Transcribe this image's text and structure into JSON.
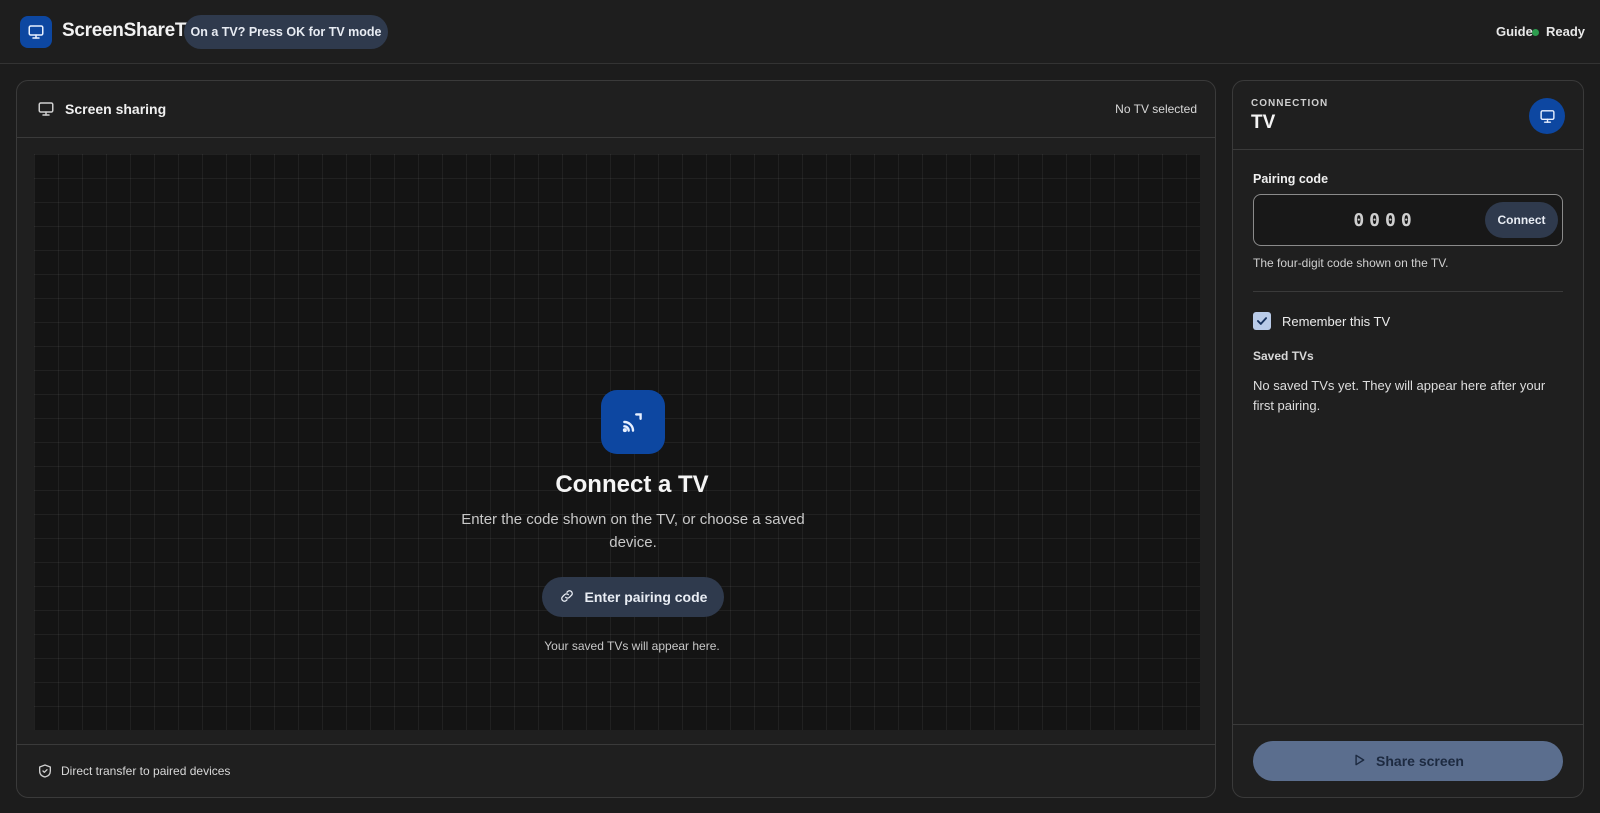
{
  "header": {
    "app_title": "ScreenShareTV",
    "tv_mode_chip": "On a TV? Press OK for TV mode",
    "guide_label": "Guide",
    "status_label": "Ready"
  },
  "main": {
    "title": "Screen sharing",
    "tv_status": "No TV selected",
    "empty_state": {
      "heading": "Connect a TV",
      "subtext": "Enter the code shown on the TV, or choose a saved device.",
      "button_label": "Enter pairing code",
      "saved_hint": "Your saved TVs will appear here."
    },
    "footer_text": "Direct transfer to paired devices"
  },
  "side": {
    "kicker": "CONNECTION",
    "title": "TV",
    "pairing_label": "Pairing code",
    "pairing_placeholder": "0000",
    "connect_label": "Connect",
    "pairing_help": "The four-digit code shown on the TV.",
    "remember_label": "Remember this TV",
    "remember_checked": true,
    "saved_heading": "Saved TVs",
    "saved_empty": "No saved TVs yet. They will appear here after your first pairing.",
    "share_label": "Share screen"
  },
  "colors": {
    "accent": "#0d47a1",
    "chip": "#2f3a4d",
    "status_ok": "#2e9d4f",
    "share_disabled": "#5b6e8e"
  },
  "icons": [
    "monitor-icon",
    "cast-icon",
    "link-icon",
    "shield-check-icon",
    "check-icon",
    "play-icon"
  ]
}
